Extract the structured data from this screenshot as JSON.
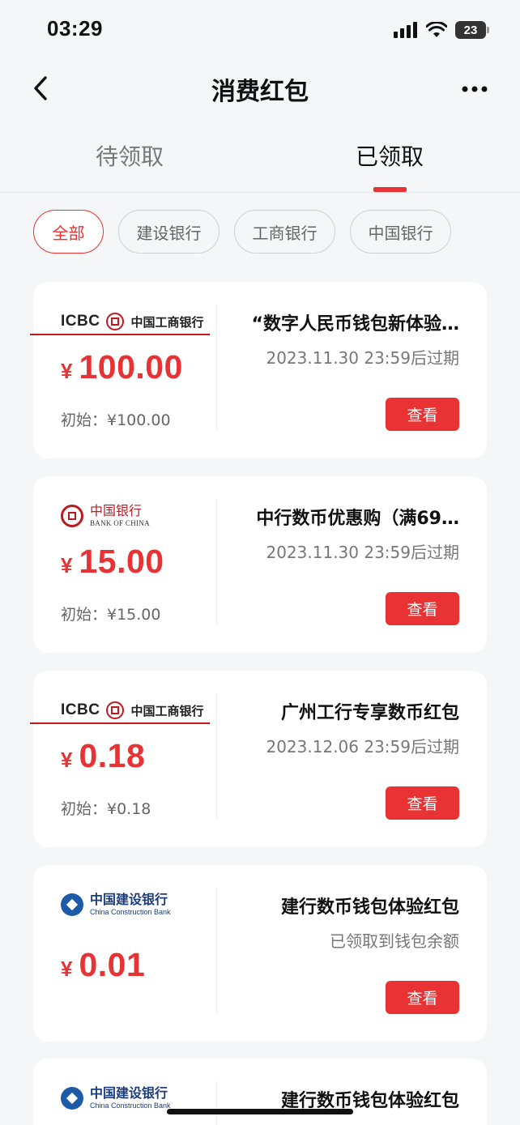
{
  "status_bar": {
    "time": "03:29",
    "battery": "23"
  },
  "nav": {
    "title": "消费红包"
  },
  "tabs": [
    {
      "label": "待领取"
    },
    {
      "label": "已领取"
    }
  ],
  "filters": [
    {
      "label": "全部"
    },
    {
      "label": "建设银行"
    },
    {
      "label": "工商银行"
    },
    {
      "label": "中国银行"
    }
  ],
  "currency_symbol": "¥",
  "view_label": "查看",
  "cards": [
    {
      "bank": "icbc",
      "logo_en": "ICBC",
      "logo_cn": "中国工商银行",
      "amount": "100.00",
      "original": "初始：¥100.00",
      "title": "“数字人民币钱包新体验…",
      "subtitle": "2023.11.30 23:59后过期"
    },
    {
      "bank": "boc",
      "logo_cn": "中国银行",
      "logo_en": "BANK OF CHINA",
      "amount": "15.00",
      "original": "初始：¥15.00",
      "title": "中行数币优惠购（满69…",
      "subtitle": "2023.11.30 23:59后过期"
    },
    {
      "bank": "icbc",
      "logo_en": "ICBC",
      "logo_cn": "中国工商银行",
      "amount": "0.18",
      "original": "初始：¥0.18",
      "title": "广州工行专享数币红包",
      "subtitle": "2023.12.06 23:59后过期"
    },
    {
      "bank": "ccb",
      "logo_cn": "中国建设银行",
      "logo_en": "China Construction Bank",
      "amount": "0.01",
      "title": "建行数币钱包体验红包",
      "subtitle": "已领取到钱包余额"
    },
    {
      "bank": "ccb",
      "logo_cn": "中国建设银行",
      "logo_en": "China Construction Bank",
      "title": "建行数币钱包体验红包"
    }
  ],
  "colors": {
    "accent": "#e83233",
    "background": "#f5f6f8"
  }
}
